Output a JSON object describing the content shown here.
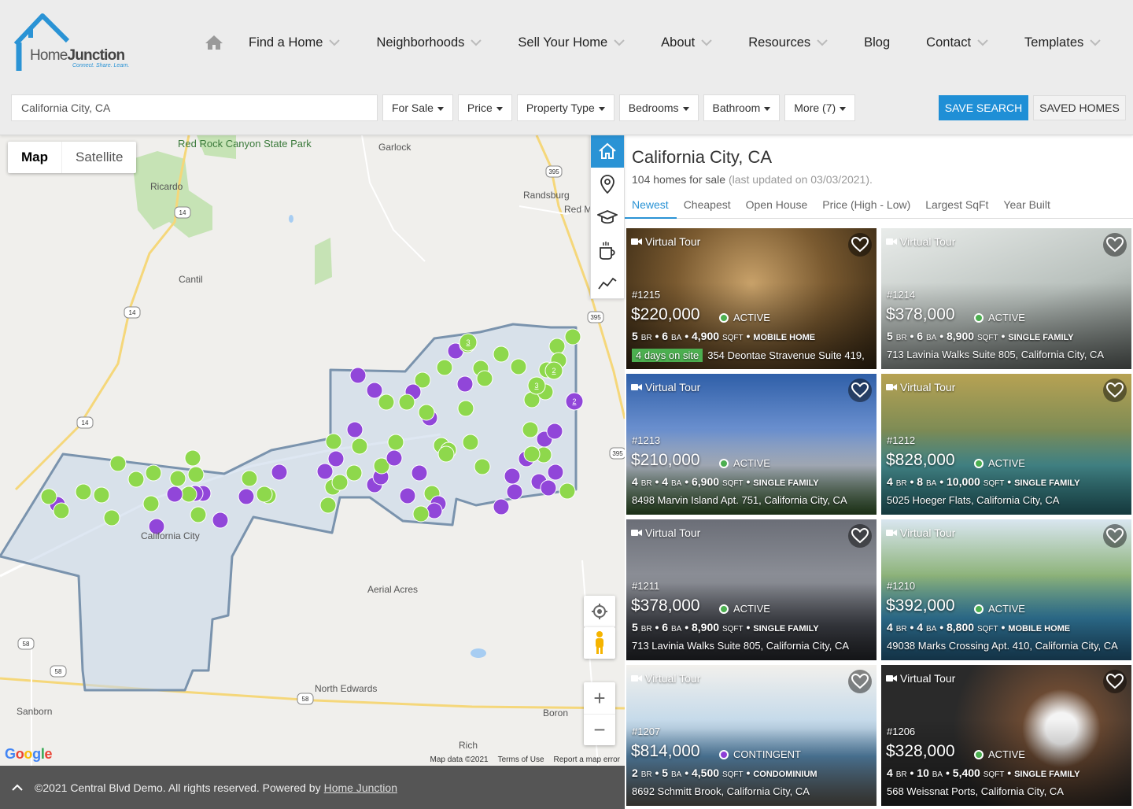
{
  "brand": {
    "name_part1": "Home",
    "name_part2": "Junction",
    "tagline": "Connect. Share. Learn."
  },
  "nav": {
    "items": [
      {
        "label": "Find a Home",
        "has_menu": true
      },
      {
        "label": "Neighborhoods",
        "has_menu": true
      },
      {
        "label": "Sell Your Home",
        "has_menu": true
      },
      {
        "label": "About",
        "has_menu": true
      },
      {
        "label": "Resources",
        "has_menu": true
      },
      {
        "label": "Blog",
        "has_menu": false
      },
      {
        "label": "Contact",
        "has_menu": true
      },
      {
        "label": "Templates",
        "has_menu": true
      }
    ]
  },
  "search": {
    "value": "California City, CA",
    "filters": [
      "For Sale",
      "Price",
      "Property Type",
      "Bedrooms",
      "Bathroom",
      "More (7)"
    ],
    "save_label": "SAVE SEARCH",
    "saved_homes_label": "SAVED HOMES"
  },
  "map": {
    "map_label": "Map",
    "satellite_label": "Satellite",
    "places": [
      "Red Rock Canyon State Park",
      "Garlock",
      "Ricardo",
      "Randsburg",
      "Red M",
      "Cantil",
      "California City",
      "Aerial Acres",
      "North Edwards",
      "Sanborn",
      "Boron",
      "Rich"
    ],
    "route_shields": [
      "395",
      "14",
      "14",
      "395",
      "14",
      "395",
      "58",
      "58",
      "58"
    ],
    "cluster_labels": [
      "3",
      "2",
      "3",
      "2"
    ],
    "google": "Google",
    "map_data": "Map data ©2021",
    "terms": "Terms of Use",
    "report": "Report a map error"
  },
  "footer": {
    "text": "©2021 Central Blvd Demo. All rights reserved. Powered by",
    "link": "Home Junction"
  },
  "results": {
    "title": "California City, CA",
    "count_text": "104 homes for sale",
    "updated_text": "(last updated on 03/03/2021).",
    "sort_tabs": [
      "Newest",
      "Cheapest",
      "Open House",
      "Price (High - Low)",
      "Largest SqFt",
      "Year Built"
    ],
    "active_sort": "Newest"
  },
  "colors": {
    "accent": "#2a93d5",
    "active": "#4caf50",
    "contingent": "#8e3fd6",
    "marker_green": "#8ed84c",
    "marker_purple": "#9146d9"
  },
  "listings": [
    {
      "mls": "#1215",
      "price": "$220,000",
      "status": "ACTIVE",
      "beds": "5",
      "baths": "6",
      "sqft": "4,900",
      "type": "MOBILE HOME",
      "days": "4 days on site",
      "address": "354 Deontae Stravenue Suite 419,",
      "virtual_tour": "Virtual Tour"
    },
    {
      "mls": "#1214",
      "price": "$378,000",
      "status": "ACTIVE",
      "beds": "5",
      "baths": "6",
      "sqft": "8,900",
      "type": "SINGLE FAMILY",
      "address": "713 Lavinia Walks Suite 805, California City, CA",
      "virtual_tour": "Virtual Tour"
    },
    {
      "mls": "#1213",
      "price": "$210,000",
      "status": "ACTIVE",
      "beds": "4",
      "baths": "4",
      "sqft": "6,900",
      "type": "SINGLE FAMILY",
      "address": "8498 Marvin Island Apt. 751, California City, CA",
      "virtual_tour": "Virtual Tour"
    },
    {
      "mls": "#1212",
      "price": "$828,000",
      "status": "ACTIVE",
      "beds": "4",
      "baths": "8",
      "sqft": "10,000",
      "type": "SINGLE FAMILY",
      "address": "5025 Hoeger Flats, California City, CA",
      "virtual_tour": "Virtual Tour"
    },
    {
      "mls": "#1211",
      "price": "$378,000",
      "status": "ACTIVE",
      "beds": "5",
      "baths": "6",
      "sqft": "8,900",
      "type": "SINGLE FAMILY",
      "address": "713 Lavinia Walks Suite 805, California City, CA",
      "virtual_tour": "Virtual Tour"
    },
    {
      "mls": "#1210",
      "price": "$392,000",
      "status": "ACTIVE",
      "beds": "4",
      "baths": "4",
      "sqft": "8,800",
      "type": "MOBILE HOME",
      "address": "49038 Marks Crossing Apt. 410, California City, CA",
      "virtual_tour": "Virtual Tour"
    },
    {
      "mls": "#1207",
      "price": "$814,000",
      "status": "CONTINGENT",
      "beds": "2",
      "baths": "5",
      "sqft": "4,500",
      "type": "CONDOMINIUM",
      "address": "8692 Schmitt Brook, California City, CA",
      "virtual_tour": "Virtual Tour"
    },
    {
      "mls": "#1206",
      "price": "$328,000",
      "status": "ACTIVE",
      "beds": "4",
      "baths": "10",
      "sqft": "5,400",
      "type": "SINGLE FAMILY",
      "address": "568 Weissnat Ports, California City, CA",
      "virtual_tour": "Virtual Tour"
    }
  ],
  "labels": {
    "br": "BR",
    "ba": "BA",
    "sqft": "SQFT"
  }
}
